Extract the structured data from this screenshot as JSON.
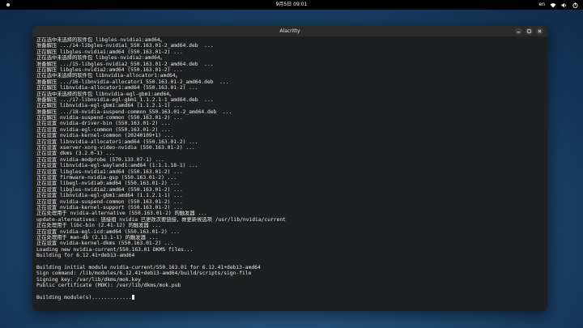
{
  "topbar": {
    "clock": "9月5日  09:01",
    "tray_lang": "en"
  },
  "icons": {
    "activities": "activities-icon",
    "network": "wifi-icon",
    "volume": "volume-icon",
    "power": "power-icon",
    "minimize": "minimize-icon",
    "maximize": "maximize-icon",
    "close": "close-icon"
  },
  "window": {
    "title": "Alacritty"
  },
  "terminal": {
    "lines": [
      "正在选中未选择的软件包 libgles-nvidia1:amd64。",
      "准备解压 .../14-libgles-nvidia1_550.163.01-2_amd64.deb  ...",
      "正在解压 libgles-nvidia1:amd64 (550.163.01-2) ...",
      "正在选中未选择的软件包 libgles-nvidia2:amd64。",
      "准备解压 .../15-libgles-nvidia2_550.163.01-2_amd64.deb  ...",
      "正在解压 libgles-nvidia2:amd64 (550.163.01-2) ...",
      "正在选中未选择的软件包 libnvidia-allocator1:amd64。",
      "准备解压 .../16-libnvidia-allocator1_550.163.01-2_amd64.deb  ...",
      "正在解压 libnvidia-allocator1:amd64 (550.163.01-2) ...",
      "正在选中未选择的软件包 libnvidia-egl-gbm1:amd64。",
      "准备解压 .../17-libnvidia-egl-gbm1_1.1.2.1-1_amd64.deb  ...",
      "正在解压 libnvidia-egl-gbm1:amd64 (1.1.2.1-1) ...",
      "准备解压 .../18-nvidia-suspend-common_550.163.01-2_amd64.deb  ...",
      "正在解压 nvidia-suspend-common (550.163.01-2) ...",
      "正在设置 nvidia-driver-bin (550.163.01-2) ...",
      "正在设置 nvidia-egl-common (550.163.01-2) ...",
      "正在设置 nvidia-kernel-common (20240109+1) ...",
      "正在设置 libnvidia-allocator1:amd64 (550.163.01-2) ...",
      "正在设置 xserver-xorg-video-nvidia (550.163.01-2) ...",
      "正在设置 dkms (3.2.0-1) ...",
      "正在设置 nvidia-modprobe (570.133.07-1) ...",
      "正在设置 libnvidia-egl-wayland1:amd64 (1:1.1.18-1) ...",
      "正在设置 libgles-nvidia1:amd64 (550.163.01-2) ...",
      "正在设置 firmware-nvidia-gsp (550.163.01-2) ...",
      "正在设置 libegl-nvidia0:amd64 (550.163.01-2) ...",
      "正在设置 libgles-nvidia2:amd64 (550.163.01-2) ...",
      "正在设置 libnvidia-egl-gbm1:amd64 (1.1.2.1-1) ...",
      "正在设置 nvidia-suspend-common (550.163.01-2) ...",
      "正在设置 nvidia-kernel-support (550.163.01-2) ...",
      "正在处理用于 nvidia-alternative (550.163.01-2) 的触发器 ...",
      "update-alternatives: 链接组 nvidia 已更改次要链接，故更新候选项 /usr/lib/nvidia/current",
      "正在处理用于 libc-bin (2.41-12) 的触发器 ...",
      "正在设置 nvidia-egl-icd:amd64 (550.163.01-2) ...",
      "正在处理用于 man-db (2.13.1-1) 的触发器 ...",
      "正在设置 nvidia-kernel-dkms (550.163.01-2) ...",
      "Loading new nvidia-current/550.163.01 DKMS files...",
      "Building for 6.12.41+deb13-amd64",
      "",
      "Building initial module nvidia-current/550.163.01 for 6.12.41+deb13-amd64",
      "Sign command: /lib/modules/6.12.41+deb13-amd64/build/scripts/sign-file",
      "Signing key: /var/lib/dkms/mok.key",
      "Public certificate (MOK): /var/lib/dkms/mok.pub",
      "",
      "Building module(s)............."
    ]
  }
}
